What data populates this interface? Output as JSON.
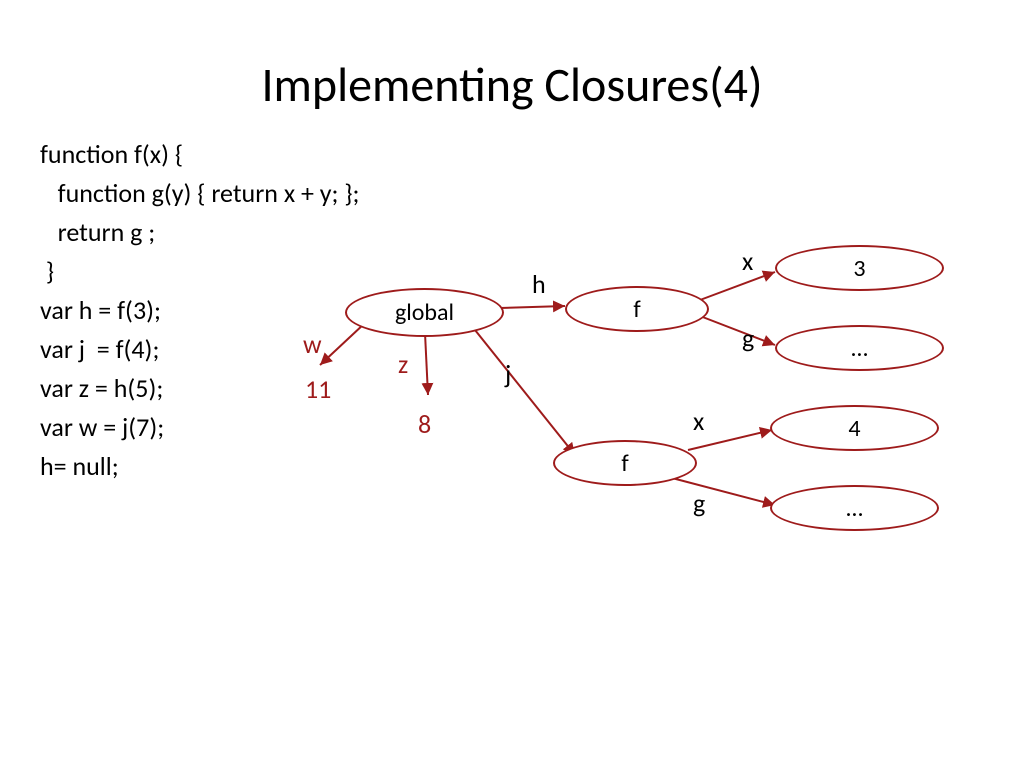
{
  "title": "Implementing Closures(4)",
  "code": {
    "l1": "function f(x) {",
    "l2": "   function g(y) { return x + y; };",
    "l3": "   return g ;",
    "l4": " }",
    "l5": "var h = f(3);",
    "l6": "var j  = f(4);",
    "l7": "var z = h(5);",
    "l8": "var w = j(7);",
    "l9": "h= null;"
  },
  "nodes": {
    "global": "global",
    "f1": "f",
    "f2": "f",
    "n3": "3",
    "n4": "4",
    "dots1": "…",
    "dots2": "…"
  },
  "labels": {
    "h": "h",
    "j": "j",
    "x1": "x",
    "g1": "g",
    "x2": "x",
    "g2": "g",
    "w": "w",
    "z": "z",
    "v11": "11",
    "v8": "8"
  },
  "colors": {
    "stroke": "#9e1b1b"
  }
}
